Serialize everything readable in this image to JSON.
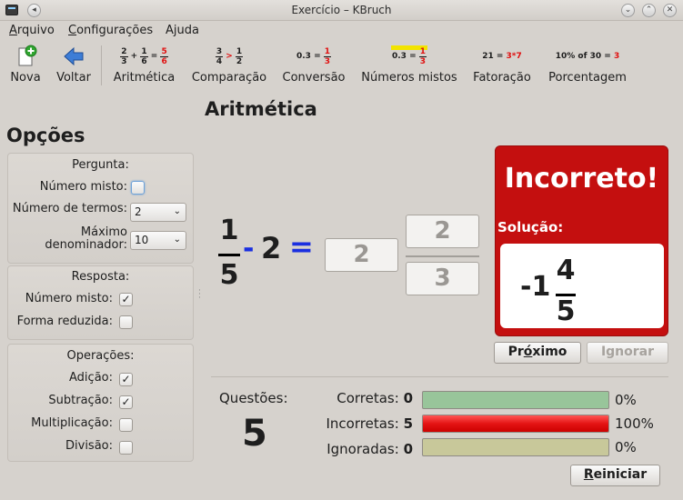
{
  "window": {
    "title": "Exercício – KBruch"
  },
  "menu": [
    {
      "label": "Arquivo",
      "mn": 0
    },
    {
      "label": "Configurações",
      "mn": 0
    },
    {
      "label": "Ajuda",
      "mn": 1
    }
  ],
  "toolbar": {
    "new_label": "Nova",
    "back_label": "Voltar",
    "modes": [
      "Aritmética",
      "Comparação",
      "Conversão",
      "Números mistos",
      "Fatoração",
      "Porcentagem"
    ],
    "icon_text": {
      "arith": {
        "a_n": "2",
        "a_d": "3",
        "op": "+",
        "b_n": "1",
        "b_d": "6",
        "eq": "=",
        "r_n": "5",
        "r_d": "6"
      },
      "compare": {
        "a_n": "3",
        "a_d": "4",
        "op": ">",
        "b_n": "1",
        "b_d": "2"
      },
      "convert": {
        "dec": "0.3",
        "eq": "=",
        "r_n": "1",
        "r_d": "3"
      },
      "mixed": {
        "dec": "0.3",
        "eq": "=",
        "r_n": "1",
        "r_d": "3"
      },
      "factor": {
        "lhs": "21 =",
        "rhs": "3*7"
      },
      "percent": {
        "lhs": "10% of 30 =",
        "rhs": "3"
      }
    },
    "colors": {
      "accent_red": "#e01010",
      "mixed_highlight": "#f2e400"
    }
  },
  "options": {
    "title": "Opções",
    "pergunta": {
      "title": "Pergunta:",
      "mixed_label": "Número misto:",
      "mixed_checked": false,
      "terms_label": "Número de termos:",
      "terms_value": "2",
      "maxden_label_1": "Máximo",
      "maxden_label_2": "denominador:",
      "maxden_value": "10"
    },
    "resposta": {
      "title": "Resposta:",
      "mixed_label": "Número misto:",
      "mixed_checked": true,
      "reduced_label": "Forma reduzida:",
      "reduced_checked": false
    },
    "operacoes": {
      "title": "Operações:",
      "add_label": "Adição:",
      "add_checked": true,
      "sub_label": "Subtração:",
      "sub_checked": true,
      "mul_label": "Multiplicação:",
      "mul_checked": false,
      "div_label": "Divisão:",
      "div_checked": false
    }
  },
  "main": {
    "title": "Aritmética",
    "task": {
      "num": "1",
      "den": "5",
      "op": "-",
      "term2": "2",
      "eq": "="
    },
    "answer": {
      "whole": "2",
      "num": "2",
      "den": "3"
    },
    "result": {
      "status": "Incorreto!",
      "solution_label": "Solução:",
      "solution": {
        "sign_whole": "-1",
        "num": "4",
        "den": "5"
      },
      "color": "#c40f0f"
    },
    "buttons": {
      "next": "Próximo",
      "skip": "Ignorar",
      "reset": "Reiniciar"
    }
  },
  "stats": {
    "questions_label": "Questões:",
    "questions_value": "5",
    "correct_label": "Corretas:",
    "correct_value": "0",
    "correct_pct": "0%",
    "correct_fraction": 0.0,
    "incorrect_label": "Incorretas:",
    "incorrect_value": "5",
    "incorrect_pct": "100%",
    "incorrect_fraction": 1.0,
    "skipped_label": "Ignoradas:",
    "skipped_value": "0",
    "skipped_pct": "0%",
    "skipped_fraction": 0.0,
    "colors": {
      "correct": "#98c59a",
      "incorrect": "#e41414",
      "skipped": "#c8c89a"
    }
  }
}
